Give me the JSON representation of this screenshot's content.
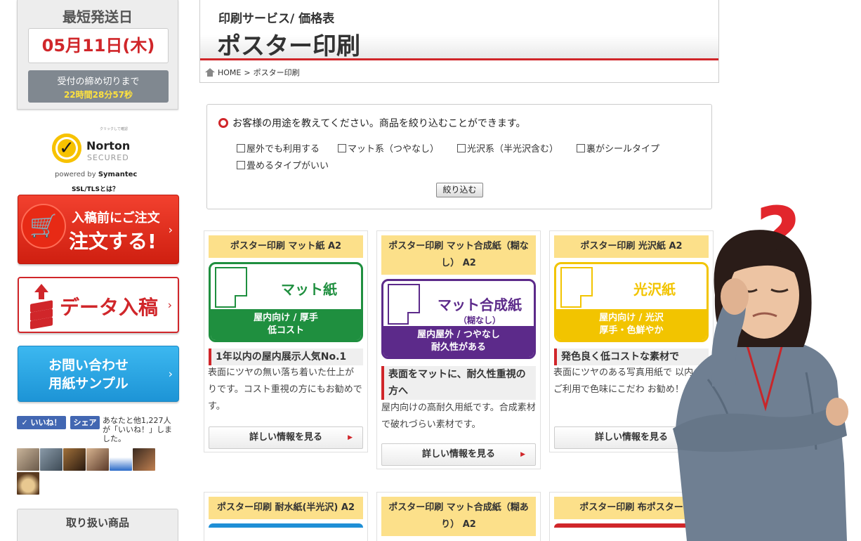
{
  "sidebar": {
    "shipping": {
      "title": "最短発送日",
      "date": "05月11日(木)",
      "deadline_label": "受付の締め切りまで",
      "deadline_time": "22時間28分57秒"
    },
    "norton": {
      "small": "クリックして確認",
      "brand": "Norton",
      "secured": "SECURED",
      "powered_prefix": "powered by ",
      "powered_brand": "Symantec"
    },
    "ssl_link": "SSL/TLSとは？",
    "order_button": {
      "sub": "入稿前にご注文",
      "main": "注文する!"
    },
    "data_button": {
      "label": "データ入稿"
    },
    "contact_button": {
      "line1": "お問い合わせ",
      "line2": "用紙サンプル"
    },
    "facebook": {
      "like": "✓ いいね！",
      "share": "シェア",
      "text": "あなたと他1,227人が「いいね！」しました。"
    },
    "products_label": "取り扱い商品"
  },
  "header": {
    "subtitle": "印刷サービス/ 価格表",
    "title": "ポスター印刷",
    "breadcrumb": {
      "home": "HOME",
      "sep": ">",
      "current": "ポスター印刷"
    }
  },
  "filter": {
    "question": "お客様の用途を教えてください。商品を絞り込むことができます。",
    "options": [
      "屋外でも利用する",
      "マット系（つやなし）",
      "光沢系（半光沢含む）",
      "裏がシールタイプ",
      "畳めるタイプがいい"
    ],
    "button": "絞り込む"
  },
  "cards": [
    {
      "title": "ポスター印刷 マット紙 A2",
      "product_name": "マット紙",
      "band": [
        "屋内向け / 厚手",
        "低コスト"
      ],
      "heading": "1年以内の屋内展示人気No.1",
      "description": "表面にツヤの無い落ち着いた仕上がりです。コスト重視の方にもお勧めです。",
      "button": "詳しい情報を見る",
      "color": "#1f8f3f"
    },
    {
      "title": "ポスター印刷 マット合成紙（糊なし） A2",
      "product_name": "マット合成紙",
      "product_sub": "（糊なし）",
      "band": [
        "屋内屋外 / つやなし",
        "耐久性がある"
      ],
      "heading": "表面をマットに、耐久性重視の方へ",
      "description": "屋内向けの高耐久用紙です。合成素材で破れづらい素材です。",
      "button": "詳しい情報を見る",
      "color": "#5c2a8a"
    },
    {
      "title": "ポスター印刷 光沢紙 A2",
      "product_name": "光沢紙",
      "band": [
        "屋内向け / 光沢",
        "厚手・色鮮やか"
      ],
      "heading": "発色良く低コストな素材で",
      "description": "表面にツヤのある写真用紙で 以内のご利用で色味にこだわ お勧め！",
      "button": "詳しい情報を見る",
      "color": "#f2c400"
    }
  ],
  "cards_row2": [
    {
      "title": "ポスター印刷 耐水紙(半光沢) A2",
      "color": "#1f8fd6"
    },
    {
      "title": "ポスター印刷 マット合成紙（糊あり） A2",
      "color": "#5c2a8a"
    },
    {
      "title": "ポスター印刷 布ポスター",
      "color": "#d0262a"
    }
  ],
  "overlay": {
    "mark": "?"
  }
}
